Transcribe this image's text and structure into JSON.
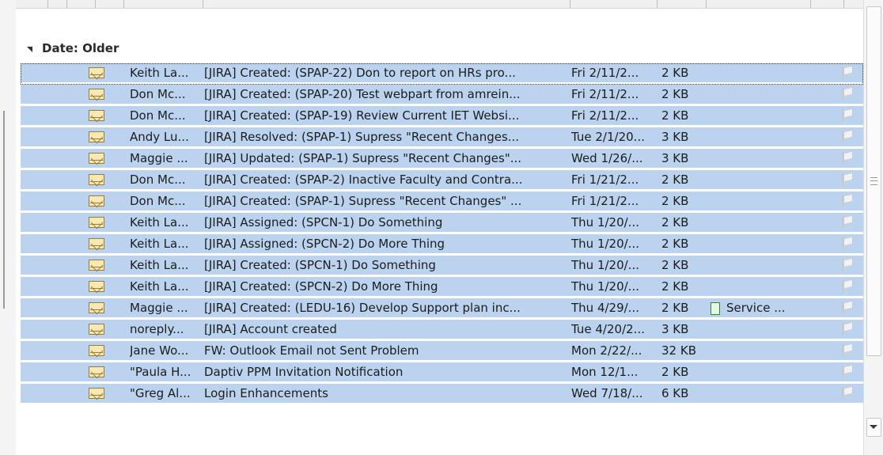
{
  "group": {
    "label": "Date: Older"
  },
  "messages": [
    {
      "from": "Keith La...",
      "subject": "[JIRA] Created: (SPAP-22) Don to report on HRs pro...",
      "received": "Fri 2/11/2...",
      "size": "2 KB",
      "category": ""
    },
    {
      "from": "Don Mc...",
      "subject": "[JIRA] Created: (SPAP-20) Test webpart from amrein...",
      "received": "Fri 2/11/2...",
      "size": "2 KB",
      "category": ""
    },
    {
      "from": "Don Mc...",
      "subject": "[JIRA] Created: (SPAP-19) Review Current IET Websi...",
      "received": "Fri 2/11/2...",
      "size": "2 KB",
      "category": ""
    },
    {
      "from": "Andy Lu...",
      "subject": "[JIRA] Resolved: (SPAP-1) Supress \"Recent Changes...",
      "received": "Tue 2/1/20...",
      "size": "3 KB",
      "category": ""
    },
    {
      "from": "Maggie ...",
      "subject": "[JIRA] Updated: (SPAP-1) Supress \"Recent Changes\"...",
      "received": "Wed 1/26/...",
      "size": "3 KB",
      "category": ""
    },
    {
      "from": "Don Mc...",
      "subject": "[JIRA] Created: (SPAP-2) Inactive Faculty and Contra...",
      "received": "Fri 1/21/2...",
      "size": "2 KB",
      "category": ""
    },
    {
      "from": "Don Mc...",
      "subject": "[JIRA] Created: (SPAP-1) Supress \"Recent Changes\" ...",
      "received": "Fri 1/21/2...",
      "size": "2 KB",
      "category": ""
    },
    {
      "from": "Keith La...",
      "subject": "[JIRA] Assigned: (SPCN-1) Do Something",
      "received": "Thu 1/20/...",
      "size": "2 KB",
      "category": ""
    },
    {
      "from": "Keith La...",
      "subject": "[JIRA] Assigned: (SPCN-2) Do More Thing",
      "received": "Thu 1/20/...",
      "size": "2 KB",
      "category": ""
    },
    {
      "from": "Keith La...",
      "subject": "[JIRA] Created: (SPCN-1) Do Something",
      "received": "Thu 1/20/...",
      "size": "2 KB",
      "category": ""
    },
    {
      "from": "Keith La...",
      "subject": "[JIRA] Created: (SPCN-2) Do More Thing",
      "received": "Thu 1/20/...",
      "size": "2 KB",
      "category": ""
    },
    {
      "from": "Maggie ...",
      "subject": "[JIRA] Created: (LEDU-16) Develop Support plan inc...",
      "received": "Thu 4/29/...",
      "size": "2 KB",
      "category": "Service ..."
    },
    {
      "from": "noreply...",
      "subject": "[JIRA] Account created",
      "received": "Tue 4/20/2...",
      "size": "3 KB",
      "category": ""
    },
    {
      "from": "Jane Wo...",
      "subject": "FW: Outlook Email not Sent Problem",
      "received": "Mon 2/22/...",
      "size": "32 KB",
      "category": ""
    },
    {
      "from": "\"Paula H...",
      "subject": "Daptiv PPM Invitation Notification",
      "received": "Mon 12/1...",
      "size": "2 KB",
      "category": ""
    },
    {
      "from": "\"Greg Al...",
      "subject": "Login Enhancements",
      "received": "Wed 7/18/...",
      "size": "6 KB",
      "category": ""
    }
  ],
  "icons": {
    "read_message": "envelope-icon",
    "flag": "flag-icon",
    "category": "category-color-box"
  },
  "colors": {
    "row_selected": "#bcd3ef",
    "row_separator": "#ffffff",
    "category_green": "#2f8a2f"
  }
}
